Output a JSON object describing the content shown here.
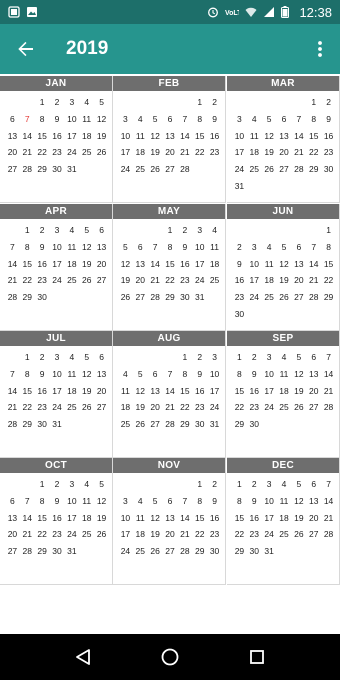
{
  "status_bar": {
    "time": "12:38",
    "left_icons": [
      "notification-icon",
      "image-icon"
    ],
    "right_icons": [
      "alarm-icon",
      "volte-icon",
      "wifi-icon",
      "signal-icon",
      "battery-icon"
    ]
  },
  "app_bar": {
    "title": "2019",
    "back_icon": "arrow-left-icon",
    "menu_icon": "more-vert-icon"
  },
  "today": {
    "month": 0,
    "day": 7
  },
  "months": [
    {
      "name": "JAN",
      "offset": 2,
      "days": 31
    },
    {
      "name": "FEB",
      "offset": 5,
      "days": 28
    },
    {
      "name": "MAR",
      "offset": 5,
      "days": 31
    },
    {
      "name": "APR",
      "offset": 1,
      "days": 30
    },
    {
      "name": "MAY",
      "offset": 3,
      "days": 31
    },
    {
      "name": "JUN",
      "offset": 6,
      "days": 30
    },
    {
      "name": "JUL",
      "offset": 1,
      "days": 31
    },
    {
      "name": "AUG",
      "offset": 4,
      "days": 31
    },
    {
      "name": "SEP",
      "offset": 0,
      "days": 30
    },
    {
      "name": "OCT",
      "offset": 2,
      "days": 31
    },
    {
      "name": "NOV",
      "offset": 5,
      "days": 30
    },
    {
      "name": "DEC",
      "offset": 0,
      "days": 31
    }
  ],
  "nav_bar": {
    "back": "nav-back-icon",
    "home": "nav-home-icon",
    "recents": "nav-recents-icon"
  },
  "colors": {
    "status_bar": "#1d6f6a",
    "app_bar": "#26958e",
    "month_header": "#6e6e6e",
    "today": "#e53935"
  }
}
